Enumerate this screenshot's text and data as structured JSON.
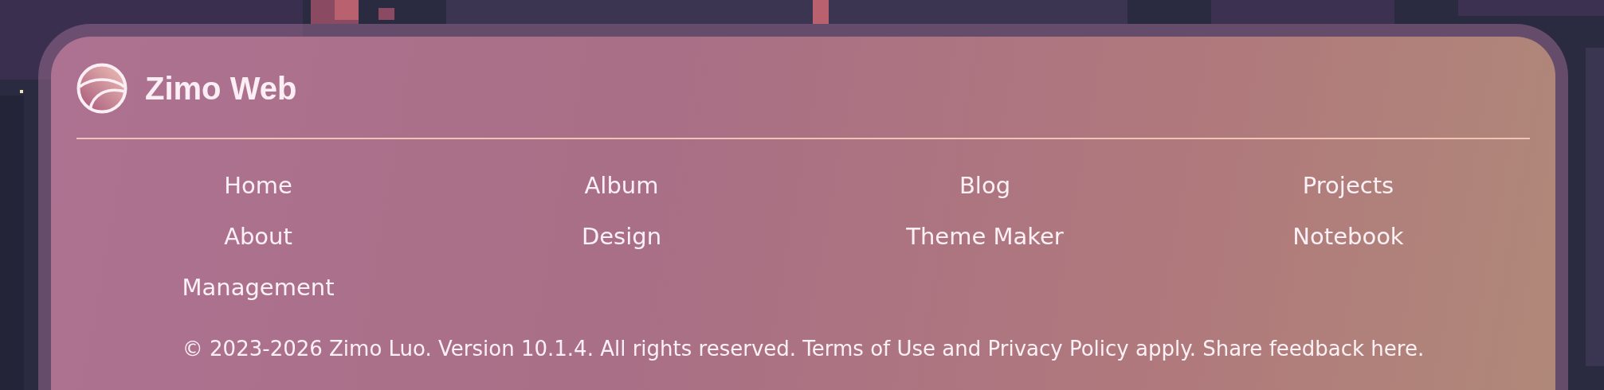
{
  "brand": {
    "title": "Zimo Web"
  },
  "nav_links": [
    "Home",
    "Album",
    "Blog",
    "Projects",
    "About",
    "Design",
    "Theme Maker",
    "Notebook",
    "Management"
  ],
  "footer": {
    "text": "© 2023-2026 Zimo Luo. Version 10.1.4. All rights reserved. Terms of Use and Privacy Policy apply. Share feedback here."
  }
}
